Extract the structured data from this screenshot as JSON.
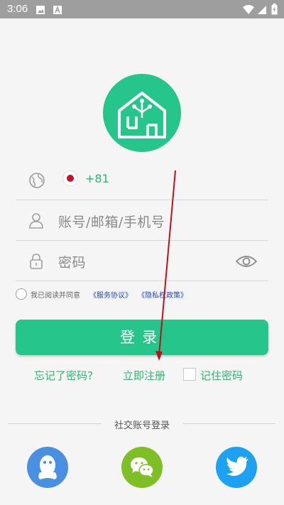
{
  "statusbar": {
    "time": "3:06"
  },
  "login": {
    "country_code": "+81",
    "account_placeholder": "账号/邮箱/手机号",
    "password_placeholder": "密码"
  },
  "agreement": {
    "text": "我已阅读并同意",
    "service": "《服务协议》",
    "privacy": "《隐私权政策》"
  },
  "buttons": {
    "login": "登录",
    "forgot": "忘记了密码?",
    "register": "立即注册",
    "remember": "记住密码"
  },
  "social": {
    "title": "社交账号登录"
  },
  "colors": {
    "brand": "#26c58b",
    "link": "#2046c9",
    "qq": "#4a90e2",
    "wechat": "#7fbf26",
    "twitter": "#1da1f2"
  }
}
